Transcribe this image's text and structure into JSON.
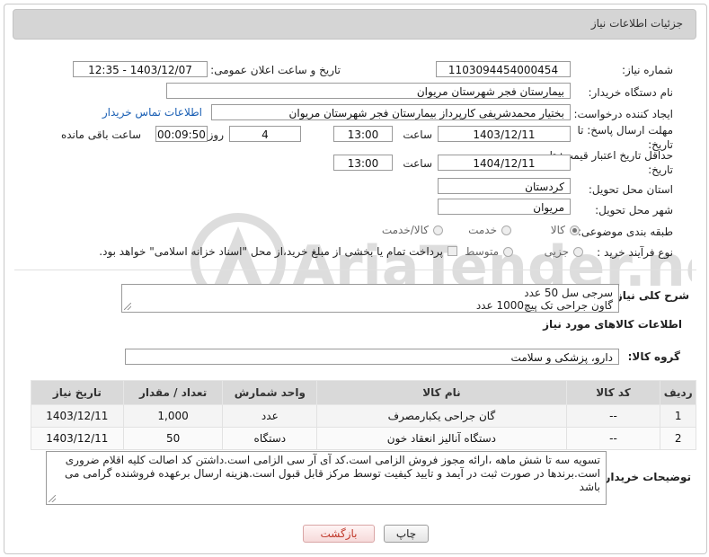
{
  "header": {
    "title": "جزئیات اطلاعات نیاز"
  },
  "form": {
    "need_number_label": "شماره نیاز:",
    "need_number": "1103094454000454",
    "announce_label": "تاریخ و ساعت اعلان عمومی:",
    "announce_value": "1403/12/07 - 12:35",
    "buyer_org_label": "نام دستگاه خریدار:",
    "buyer_org": "بیمارستان فجر شهرستان مریوان",
    "creator_label": "ایجاد کننده درخواست:",
    "creator": "بختیار محمدشریفی کارپرداز بیمارستان فجر شهرستان مریوان",
    "contact_link": "اطلاعات تماس خریدار",
    "deadline_label_1": "مهلت ارسال پاسخ: تا",
    "deadline_label_2": "تاریخ:",
    "deadline_date": "1403/12/11",
    "time_label": "ساعت",
    "deadline_time": "13:00",
    "days_value": "4",
    "days_label": "روز و",
    "remaining_time": "00:09:50",
    "remaining_label": "ساعت باقی مانده",
    "min_validity_label_1": "حداقل تاریخ اعتبار قیمت: تا",
    "min_validity_label_2": "تاریخ:",
    "min_validity_date": "1404/12/11",
    "min_validity_time": "13:00",
    "province_label": "استان محل تحویل:",
    "province": "کردستان",
    "city_label": "شهر محل تحویل:",
    "city": "مریوان",
    "category_label": "طبقه بندی موضوعی:",
    "category_options": [
      "کالا",
      "خدمت",
      "کالا/خدمت"
    ],
    "process_label": "نوع فرآیند خرید :",
    "process_options": [
      "جزیی",
      "متوسط"
    ],
    "payment_note": "پرداخت تمام یا بخشی از مبلغ خرید،از محل \"اسناد خزانه اسلامی\" خواهد بود."
  },
  "summary": {
    "label": "شرح کلی نیاز:",
    "lines": [
      "سرجی سل 50 عدد",
      "گاون جراحی تک پیچ1000 عدد"
    ]
  },
  "goods": {
    "section_title": "اطلاعات کالاهای مورد نیاز",
    "group_label": "گروه کالا:",
    "group_value": "دارو، پزشکی و سلامت",
    "columns": [
      "ردیف",
      "کد کالا",
      "نام کالا",
      "واحد شمارش",
      "تعداد / مقدار",
      "تاریخ نیاز"
    ],
    "rows": [
      [
        "1",
        "--",
        "گان جراحی یکبارمصرف",
        "عدد",
        "1,000",
        "1403/12/11"
      ],
      [
        "2",
        "--",
        "دستگاه آنالیز انعقاد خون",
        "دستگاه",
        "50",
        "1403/12/11"
      ]
    ]
  },
  "buyer_notes": {
    "label": "توضیحات خریدار:",
    "text": "تسویه سه تا شش ماهه ،ارائه مجوز فروش  الزامی است.کد آی آر سی الزامی است.داشتن کد اصالت کلیه اقلام ضروری است.برندها در صورت ثبت در آیمد و تایید کیفیت توسط مرکز قابل قبول است.هزینه ارسال برعهده فروشنده گرامی می باشد"
  },
  "buttons": {
    "print": "چاپ",
    "back": "بازگشت"
  },
  "watermark": {
    "text": "AriaTender.neT"
  }
}
